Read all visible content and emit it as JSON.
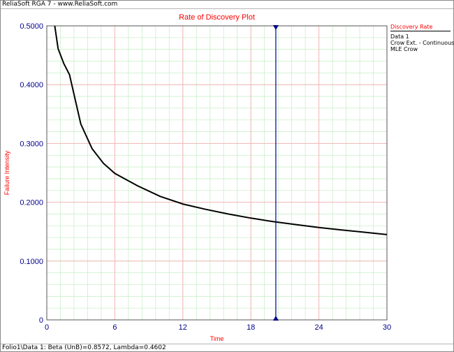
{
  "window": {
    "title": "ReliaSoft RGA 7 - www.ReliaSoft.com",
    "status": "Folio1\\Data 1: Beta (UnB)=0.8572, Lambda=0.4602"
  },
  "legend": {
    "title": "Discovery Rate",
    "items": [
      "Data 1",
      "Crow Ext. - Continuous",
      "MLE Crow"
    ]
  },
  "colors": {
    "title": "#ff0000",
    "axis_label": "#ff0000",
    "tick_label": "#00008b",
    "curve": "#000000",
    "marker": "#00008b",
    "grid_major": "#f4b6b6",
    "grid_minor": "#c9efc9"
  },
  "chart_data": {
    "type": "line",
    "title": "Rate of Discovery Plot",
    "xlabel": "Time",
    "ylabel": "Failure Intensity",
    "xlim": [
      0,
      30
    ],
    "ylim": [
      0,
      0.5
    ],
    "xticks": [
      "0",
      "6",
      "12",
      "18",
      "24",
      "30"
    ],
    "yticks": [
      "0",
      "0.1000",
      "0.2000",
      "0.3000",
      "0.4000",
      "0.5000"
    ],
    "grid": true,
    "vertical_marker_x": 20.2,
    "series": [
      {
        "x": [
          0.7,
          1,
          1.5,
          2,
          3,
          4,
          5,
          6,
          8,
          10,
          12,
          14,
          16,
          18,
          20,
          22,
          24,
          26,
          28,
          30
        ],
        "y": [
          0.5,
          0.461,
          0.436,
          0.417,
          0.333,
          0.291,
          0.266,
          0.249,
          0.228,
          0.21,
          0.197,
          0.188,
          0.18,
          0.173,
          0.167,
          0.162,
          0.157,
          0.153,
          0.149,
          0.145
        ]
      }
    ]
  }
}
